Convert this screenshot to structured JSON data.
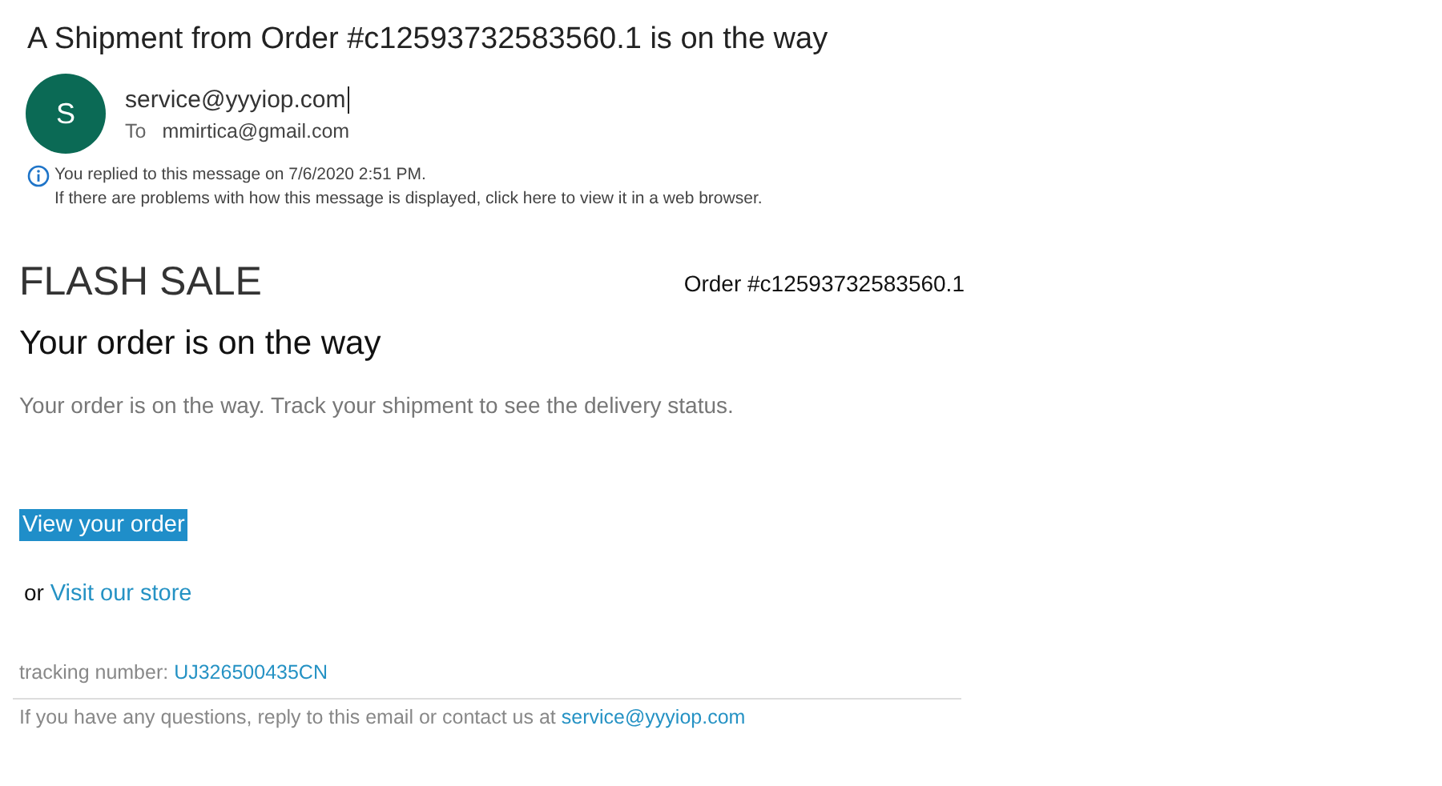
{
  "message": {
    "subject": "A Shipment from Order #c12593732583560.1 is on the way",
    "avatar_letter": "S",
    "from": "service@yyyiop.com",
    "to_label": "To",
    "to": "mmirtica@gmail.com",
    "info_lines": [
      "You replied to this message on 7/6/2020 2:51 PM.",
      "If there are problems with how this message is displayed, click here to view it in a web browser."
    ]
  },
  "email_body": {
    "brand": "FLASH SALE",
    "order_number": "Order #c12593732583560.1",
    "heading": "Your order is on the way",
    "intro": "Your order is on the way. Track your shipment to see the delivery status.",
    "primary_button": "View your order",
    "secondary": {
      "prefix": "or",
      "link": "Visit our store"
    },
    "tracking": {
      "label": "tracking number:",
      "value": "UJ326500435CN"
    },
    "footer": {
      "text": "If you have any questions, reply to this email or contact us at",
      "link": "service@yyyiop.com"
    }
  }
}
